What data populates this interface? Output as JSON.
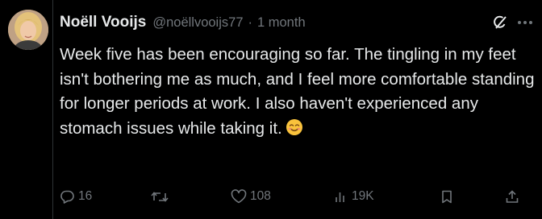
{
  "tweet": {
    "author": {
      "display_name": "Noëll Vooijs",
      "handle": "@noëllvooijs77",
      "separator": "·",
      "time": "1 month",
      "avatar_icon": "avatar-photo"
    },
    "text": "Week five has been encouraging so far. The tingling in my feet isn't bothering me as much, and I feel more comfortable standing for longer periods at work. I also haven't experienced any stomach issues while taking it.",
    "emoji": "smiling-face-emoji",
    "top_icons": [
      "grok-icon",
      "more-icon"
    ],
    "actions": {
      "replies": "16",
      "reposts": "",
      "likes": "108",
      "views": "19K"
    }
  },
  "colors": {
    "background": "#000000",
    "primary_text": "#e7e9ea",
    "secondary_text": "#71767b",
    "divider": "#2f3336"
  }
}
